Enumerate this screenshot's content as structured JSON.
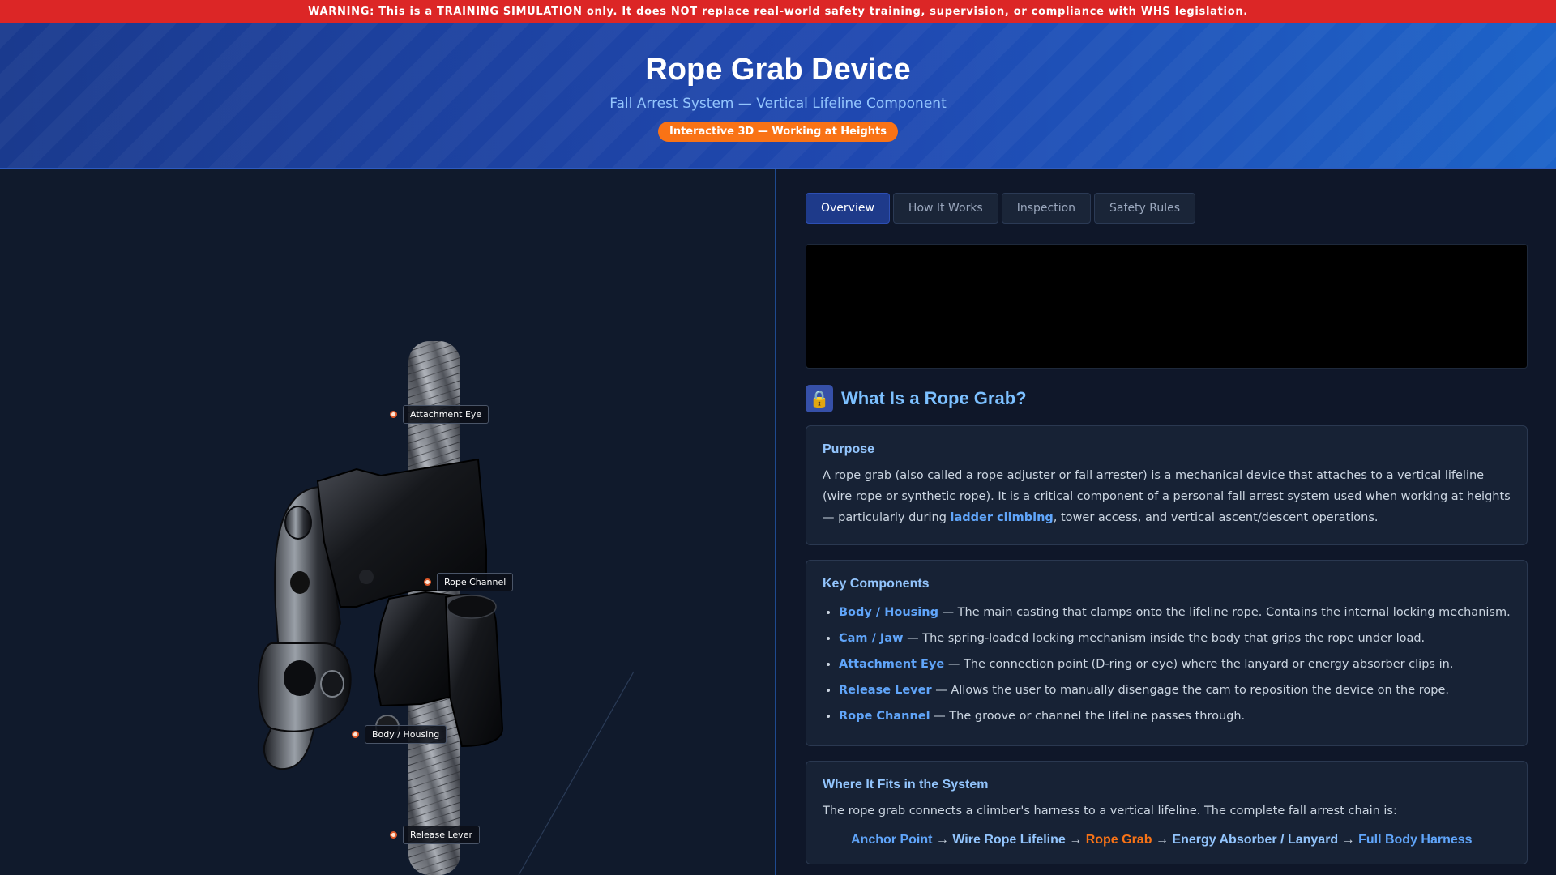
{
  "warning": "WARNING: This is a TRAINING SIMULATION only. It does NOT replace real-world safety training, supervision, or compliance with WHS legislation.",
  "header": {
    "title": "Rope Grab Device",
    "subtitle": "Fall Arrest System — Vertical Lifeline Component",
    "badge": "Interactive 3D — Working at Heights"
  },
  "viewer": {
    "labels": {
      "attachment_eye": "Attachment Eye",
      "rope_channel": "Rope Channel",
      "body_housing": "Body / Housing",
      "release_lever": "Release Lever"
    }
  },
  "tabs": [
    {
      "label": "Overview",
      "active": true
    },
    {
      "label": "How It Works",
      "active": false
    },
    {
      "label": "Inspection",
      "active": false
    },
    {
      "label": "Safety Rules",
      "active": false
    }
  ],
  "section": {
    "icon": "lock-icon",
    "title": "What Is a Rope Grab?"
  },
  "purpose": {
    "heading": "Purpose",
    "text_before": "A rope grab (also called a rope adjuster or fall arrester) is a mechanical device that attaches to a vertical lifeline (wire rope or synthetic rope). It is a critical component of a personal fall arrest system used when working at heights — particularly during ",
    "highlight": "ladder climbing",
    "text_after": ", tower access, and vertical ascent/descent operations."
  },
  "components": {
    "heading": "Key Components",
    "items": [
      {
        "name": "Body / Housing",
        "desc": " — The main casting that clamps onto the lifeline rope. Contains the internal locking mechanism."
      },
      {
        "name": "Cam / Jaw",
        "desc": " — The spring-loaded locking mechanism inside the body that grips the rope under load."
      },
      {
        "name": "Attachment Eye",
        "desc": " — The connection point (D-ring or eye) where the lanyard or energy absorber clips in."
      },
      {
        "name": "Release Lever",
        "desc": " — Allows the user to manually disengage the cam to reposition the device on the rope."
      },
      {
        "name": "Rope Channel",
        "desc": " — The groove or channel the lifeline passes through."
      }
    ]
  },
  "system": {
    "heading": "Where It Fits in the System",
    "text": "The rope grab connects a climber's harness to a vertical lifeline. The complete fall arrest chain is:",
    "chain": [
      "Anchor Point",
      "Wire Rope Lifeline",
      "Rope Grab",
      "Energy Absorber / Lanyard",
      "Full Body Harness"
    ],
    "arrow": "→"
  },
  "colors": {
    "warning": "#dc2626",
    "accent_orange": "#f97316",
    "accent_blue": "#60a5fa",
    "header_blue": "#1f48b0"
  }
}
